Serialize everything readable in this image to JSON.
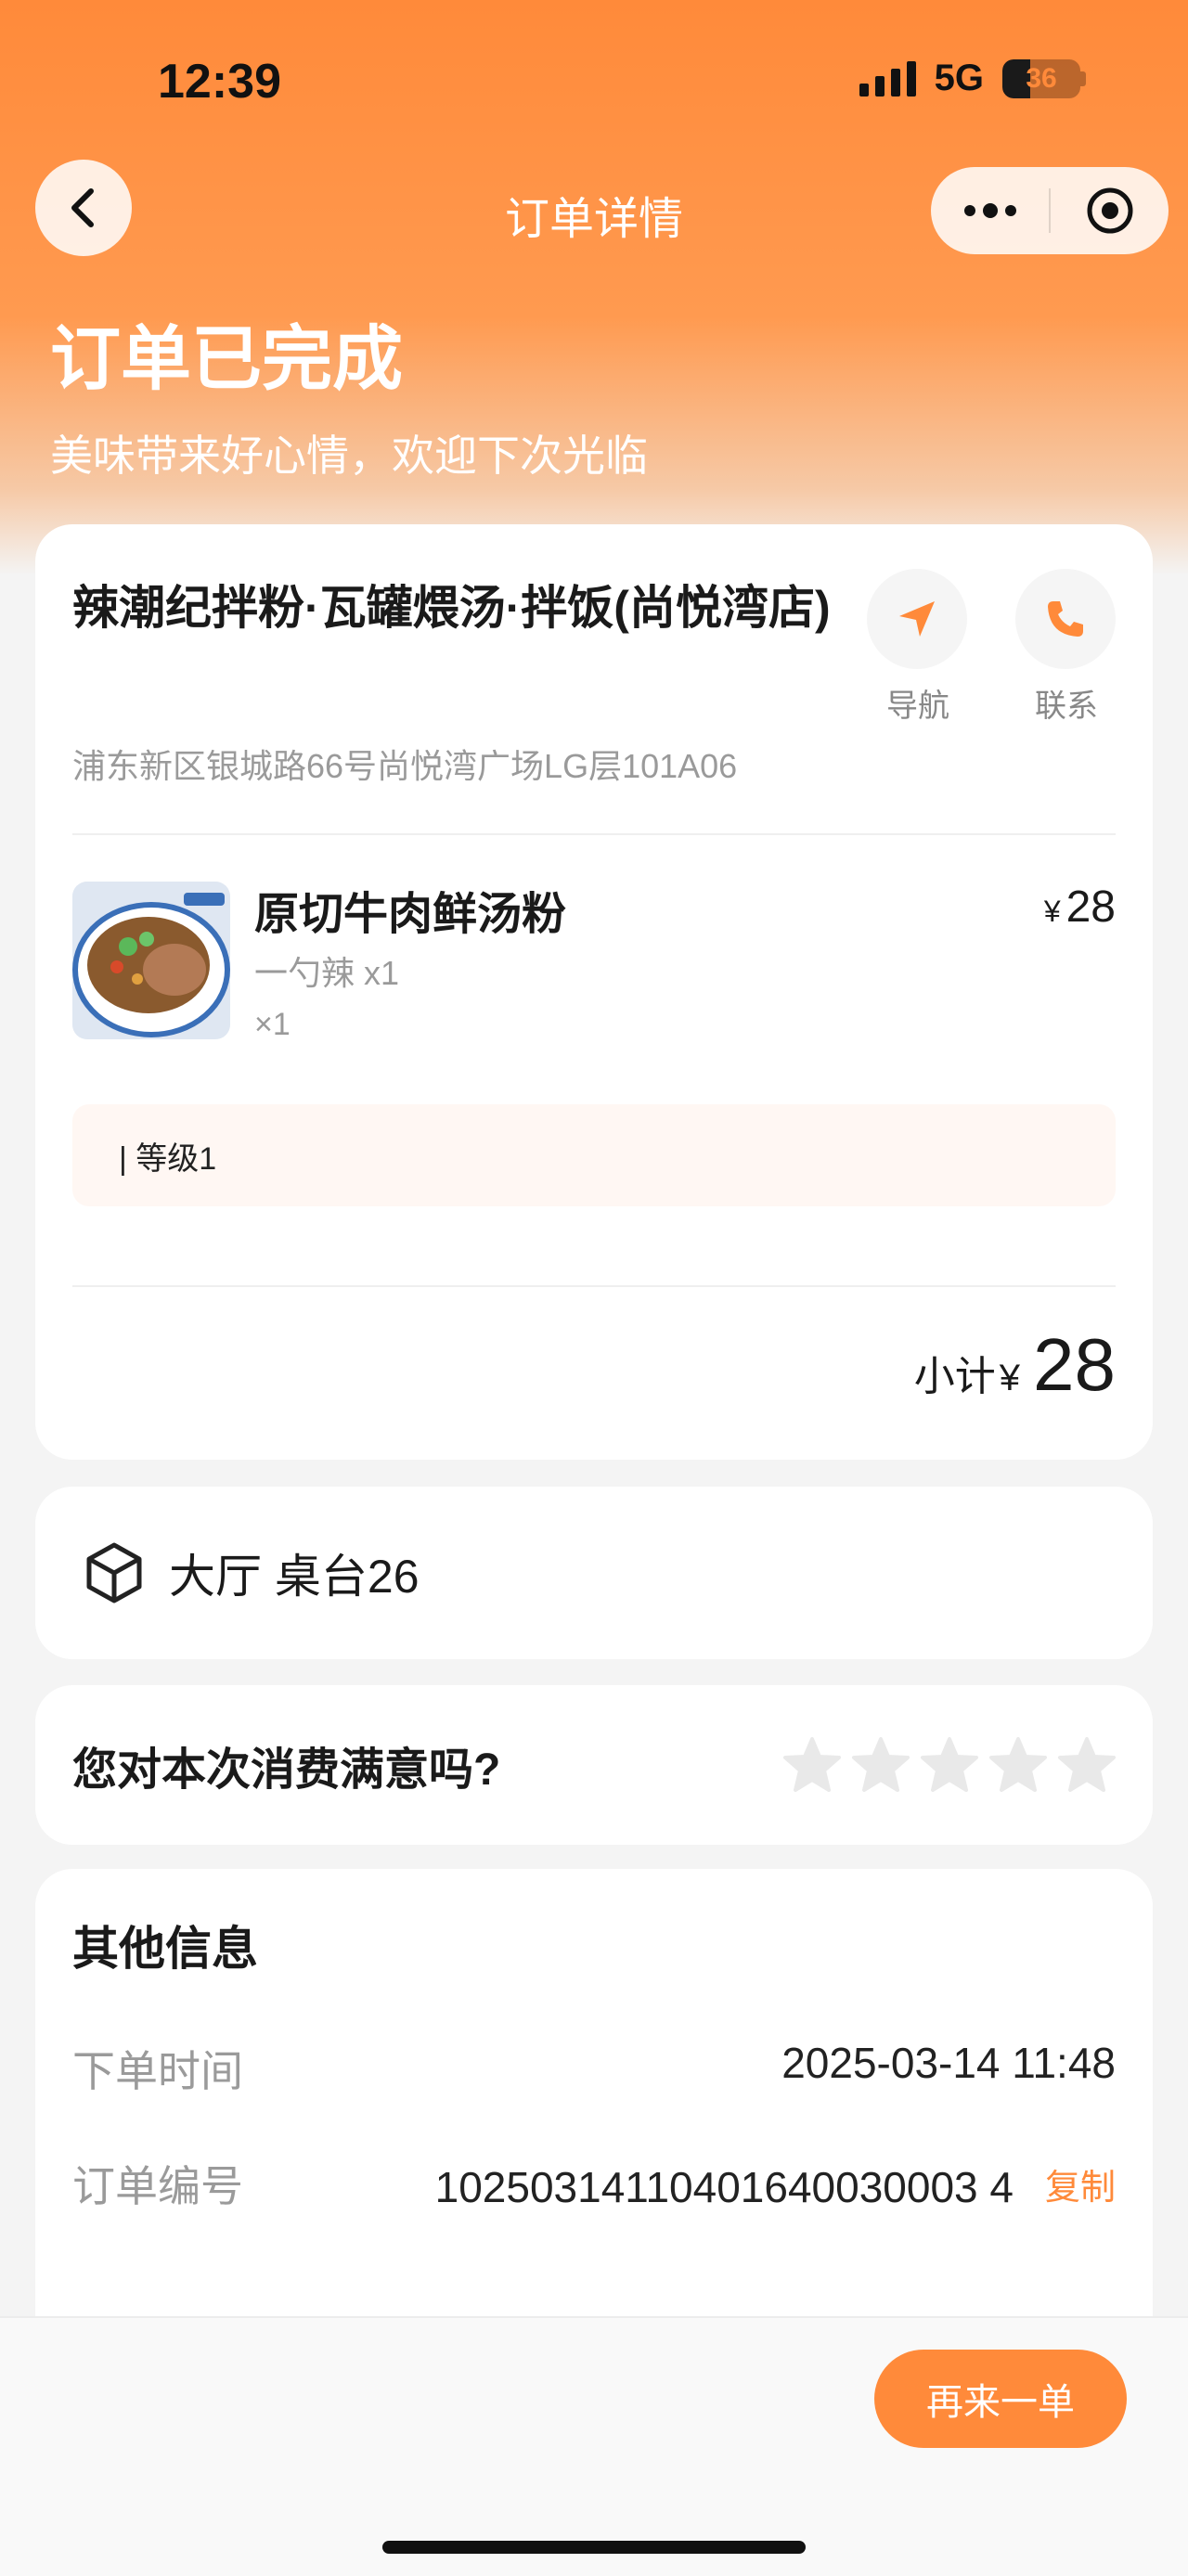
{
  "status_bar": {
    "time": "12:39",
    "network": "5G",
    "battery": "36",
    "battery_level": 0.36
  },
  "nav": {
    "title": "订单详情",
    "back_icon": "chevron-left-icon",
    "more_icon": "more-dots-icon",
    "close_icon": "target-icon"
  },
  "order_status": {
    "title": "订单已完成",
    "subtitle": "美味带来好心情，欢迎下次光临"
  },
  "store": {
    "name": "辣潮纪拌粉·瓦罐煨汤·拌饭(尚悦湾店)",
    "address": "浦东新区银城路66号尚悦湾广场LG层101A06",
    "navigate_label": "导航",
    "contact_label": "联系"
  },
  "item": {
    "name": "原切牛肉鲜汤粉",
    "currency": "¥",
    "price": "28",
    "spec": "一勺辣 x1",
    "qty": "×1"
  },
  "level": {
    "text": "| 等级1"
  },
  "subtotal": {
    "label": "小计",
    "currency": "¥",
    "value": "28"
  },
  "table": {
    "text": "大厅 桌台26"
  },
  "rating": {
    "question": "您对本次消费满意吗?",
    "stars": 5,
    "selected": 0
  },
  "other_info": {
    "title": "其他信息",
    "order_time_label": "下单时间",
    "order_time": "2025-03-14 11:48",
    "order_no_label": "订单编号",
    "order_no": "10250314110401640030003 4",
    "copy_label": "复制"
  },
  "bottom": {
    "reorder_label": "再来一单"
  },
  "colors": {
    "accent": "#ff8a3a",
    "background": "#f4f4f4"
  }
}
